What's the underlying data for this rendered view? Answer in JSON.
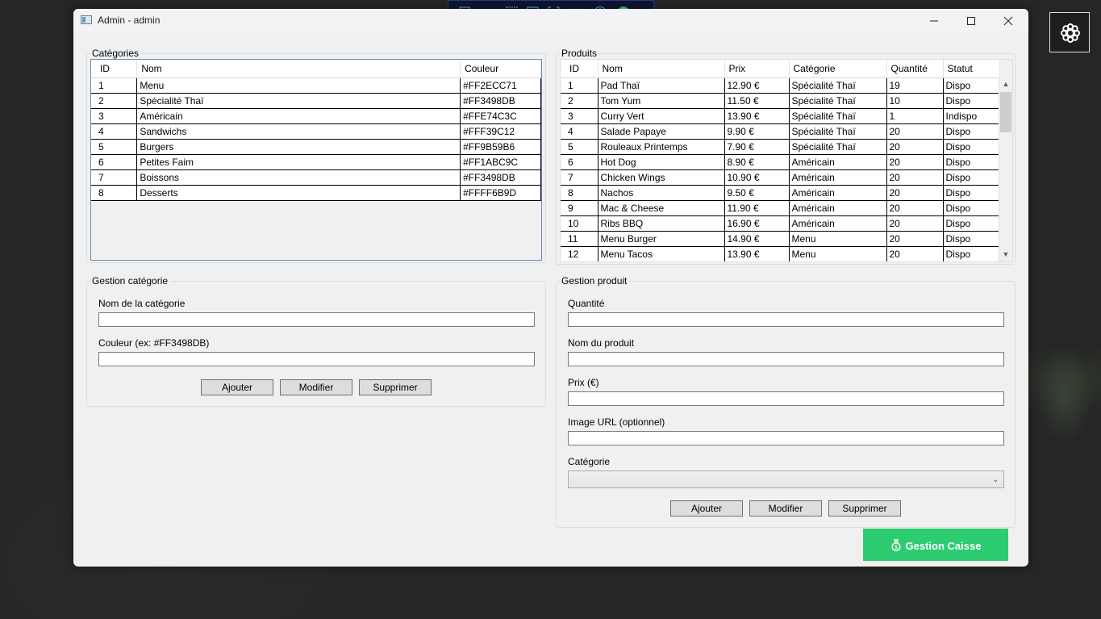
{
  "window": {
    "title": "Admin - admin"
  },
  "categories": {
    "group_label": "Catégories",
    "columns": [
      "ID",
      "Nom",
      "Couleur"
    ],
    "rows": [
      [
        "1",
        "Menu",
        "#FF2ECC71"
      ],
      [
        "2",
        "Spécialité Thaï",
        "#FF3498DB"
      ],
      [
        "3",
        "Américain",
        "#FFE74C3C"
      ],
      [
        "4",
        "Sandwichs",
        "#FFF39C12"
      ],
      [
        "5",
        "Burgers",
        "#FF9B59B6"
      ],
      [
        "6",
        "Petites Faim",
        "#FF1ABC9C"
      ],
      [
        "7",
        "Boissons",
        "#FF3498DB"
      ],
      [
        "8",
        "Desserts",
        "#FFFF6B9D"
      ]
    ]
  },
  "products": {
    "group_label": "Produits",
    "columns": [
      "ID",
      "Nom",
      "Prix",
      "Catégorie",
      "Quantité",
      "Statut"
    ],
    "rows": [
      [
        "1",
        "Pad Thaï",
        "12.90 €",
        "Spécialité Thaï",
        "19",
        "Dispo"
      ],
      [
        "2",
        "Tom Yum",
        "11.50 €",
        "Spécialité Thaï",
        "10",
        "Dispo"
      ],
      [
        "3",
        "Curry Vert",
        "13.90 €",
        "Spécialité Thaï",
        "1",
        "Indispo"
      ],
      [
        "4",
        "Salade Papaye",
        "9.90 €",
        "Spécialité Thaï",
        "20",
        "Dispo"
      ],
      [
        "5",
        "Rouleaux Printemps",
        "7.90 €",
        "Spécialité Thaï",
        "20",
        "Dispo"
      ],
      [
        "6",
        "Hot Dog",
        "8.90 €",
        "Américain",
        "20",
        "Dispo"
      ],
      [
        "7",
        "Chicken Wings",
        "10.90 €",
        "Américain",
        "20",
        "Dispo"
      ],
      [
        "8",
        "Nachos",
        "9.50 €",
        "Américain",
        "20",
        "Dispo"
      ],
      [
        "9",
        "Mac & Cheese",
        "11.90 €",
        "Américain",
        "20",
        "Dispo"
      ],
      [
        "10",
        "Ribs BBQ",
        "16.90 €",
        "Américain",
        "20",
        "Dispo"
      ],
      [
        "11",
        "Menu Burger",
        "14.90 €",
        "Menu",
        "20",
        "Dispo"
      ],
      [
        "12",
        "Menu Tacos",
        "13.90 €",
        "Menu",
        "20",
        "Dispo"
      ]
    ]
  },
  "category_form": {
    "group_label": "Gestion catégorie",
    "name_label": "Nom de la catégorie",
    "name_value": "",
    "color_label": "Couleur (ex: #FF3498DB)",
    "color_value": "",
    "add": "Ajouter",
    "edit": "Modifier",
    "delete": "Supprimer"
  },
  "product_form": {
    "group_label": "Gestion produit",
    "qty_label": "Quantité",
    "qty_value": "",
    "name_label": "Nom du produit",
    "name_value": "",
    "price_label": "Prix (€)",
    "price_value": "",
    "image_label": "Image URL (optionnel)",
    "image_value": "",
    "category_label": "Catégorie",
    "category_value": "",
    "add": "Ajouter",
    "edit": "Modifier",
    "delete": "Supprimer"
  },
  "caisse_button": {
    "label": "Gestion Caisse",
    "icon": "money-bag-icon",
    "color": "#2ECC71"
  },
  "colors": {
    "grid_border": "#688CAF",
    "window_bg": "#F0F0F0",
    "toolbar_bg": "#0E1633"
  },
  "icons": [
    "settings-gear-icon",
    "minimize-icon",
    "maximize-icon",
    "close-icon"
  ]
}
